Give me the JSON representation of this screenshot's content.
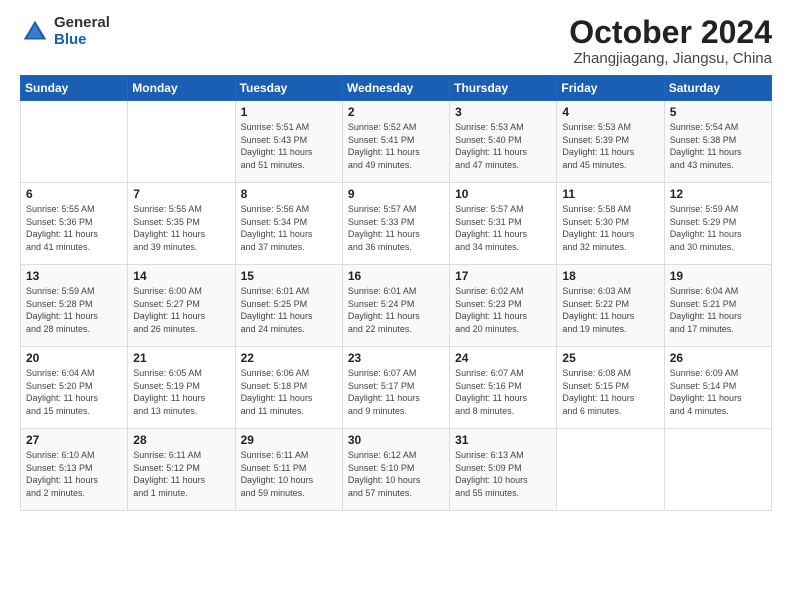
{
  "logo": {
    "general": "General",
    "blue": "Blue"
  },
  "header": {
    "month": "October 2024",
    "location": "Zhangjiagang, Jiangsu, China"
  },
  "weekdays": [
    "Sunday",
    "Monday",
    "Tuesday",
    "Wednesday",
    "Thursday",
    "Friday",
    "Saturday"
  ],
  "weeks": [
    [
      {
        "day": "",
        "info": ""
      },
      {
        "day": "",
        "info": ""
      },
      {
        "day": "1",
        "info": "Sunrise: 5:51 AM\nSunset: 5:43 PM\nDaylight: 11 hours\nand 51 minutes."
      },
      {
        "day": "2",
        "info": "Sunrise: 5:52 AM\nSunset: 5:41 PM\nDaylight: 11 hours\nand 49 minutes."
      },
      {
        "day": "3",
        "info": "Sunrise: 5:53 AM\nSunset: 5:40 PM\nDaylight: 11 hours\nand 47 minutes."
      },
      {
        "day": "4",
        "info": "Sunrise: 5:53 AM\nSunset: 5:39 PM\nDaylight: 11 hours\nand 45 minutes."
      },
      {
        "day": "5",
        "info": "Sunrise: 5:54 AM\nSunset: 5:38 PM\nDaylight: 11 hours\nand 43 minutes."
      }
    ],
    [
      {
        "day": "6",
        "info": "Sunrise: 5:55 AM\nSunset: 5:36 PM\nDaylight: 11 hours\nand 41 minutes."
      },
      {
        "day": "7",
        "info": "Sunrise: 5:55 AM\nSunset: 5:35 PM\nDaylight: 11 hours\nand 39 minutes."
      },
      {
        "day": "8",
        "info": "Sunrise: 5:56 AM\nSunset: 5:34 PM\nDaylight: 11 hours\nand 37 minutes."
      },
      {
        "day": "9",
        "info": "Sunrise: 5:57 AM\nSunset: 5:33 PM\nDaylight: 11 hours\nand 36 minutes."
      },
      {
        "day": "10",
        "info": "Sunrise: 5:57 AM\nSunset: 5:31 PM\nDaylight: 11 hours\nand 34 minutes."
      },
      {
        "day": "11",
        "info": "Sunrise: 5:58 AM\nSunset: 5:30 PM\nDaylight: 11 hours\nand 32 minutes."
      },
      {
        "day": "12",
        "info": "Sunrise: 5:59 AM\nSunset: 5:29 PM\nDaylight: 11 hours\nand 30 minutes."
      }
    ],
    [
      {
        "day": "13",
        "info": "Sunrise: 5:59 AM\nSunset: 5:28 PM\nDaylight: 11 hours\nand 28 minutes."
      },
      {
        "day": "14",
        "info": "Sunrise: 6:00 AM\nSunset: 5:27 PM\nDaylight: 11 hours\nand 26 minutes."
      },
      {
        "day": "15",
        "info": "Sunrise: 6:01 AM\nSunset: 5:25 PM\nDaylight: 11 hours\nand 24 minutes."
      },
      {
        "day": "16",
        "info": "Sunrise: 6:01 AM\nSunset: 5:24 PM\nDaylight: 11 hours\nand 22 minutes."
      },
      {
        "day": "17",
        "info": "Sunrise: 6:02 AM\nSunset: 5:23 PM\nDaylight: 11 hours\nand 20 minutes."
      },
      {
        "day": "18",
        "info": "Sunrise: 6:03 AM\nSunset: 5:22 PM\nDaylight: 11 hours\nand 19 minutes."
      },
      {
        "day": "19",
        "info": "Sunrise: 6:04 AM\nSunset: 5:21 PM\nDaylight: 11 hours\nand 17 minutes."
      }
    ],
    [
      {
        "day": "20",
        "info": "Sunrise: 6:04 AM\nSunset: 5:20 PM\nDaylight: 11 hours\nand 15 minutes."
      },
      {
        "day": "21",
        "info": "Sunrise: 6:05 AM\nSunset: 5:19 PM\nDaylight: 11 hours\nand 13 minutes."
      },
      {
        "day": "22",
        "info": "Sunrise: 6:06 AM\nSunset: 5:18 PM\nDaylight: 11 hours\nand 11 minutes."
      },
      {
        "day": "23",
        "info": "Sunrise: 6:07 AM\nSunset: 5:17 PM\nDaylight: 11 hours\nand 9 minutes."
      },
      {
        "day": "24",
        "info": "Sunrise: 6:07 AM\nSunset: 5:16 PM\nDaylight: 11 hours\nand 8 minutes."
      },
      {
        "day": "25",
        "info": "Sunrise: 6:08 AM\nSunset: 5:15 PM\nDaylight: 11 hours\nand 6 minutes."
      },
      {
        "day": "26",
        "info": "Sunrise: 6:09 AM\nSunset: 5:14 PM\nDaylight: 11 hours\nand 4 minutes."
      }
    ],
    [
      {
        "day": "27",
        "info": "Sunrise: 6:10 AM\nSunset: 5:13 PM\nDaylight: 11 hours\nand 2 minutes."
      },
      {
        "day": "28",
        "info": "Sunrise: 6:11 AM\nSunset: 5:12 PM\nDaylight: 11 hours\nand 1 minute."
      },
      {
        "day": "29",
        "info": "Sunrise: 6:11 AM\nSunset: 5:11 PM\nDaylight: 10 hours\nand 59 minutes."
      },
      {
        "day": "30",
        "info": "Sunrise: 6:12 AM\nSunset: 5:10 PM\nDaylight: 10 hours\nand 57 minutes."
      },
      {
        "day": "31",
        "info": "Sunrise: 6:13 AM\nSunset: 5:09 PM\nDaylight: 10 hours\nand 55 minutes."
      },
      {
        "day": "",
        "info": ""
      },
      {
        "day": "",
        "info": ""
      }
    ]
  ]
}
